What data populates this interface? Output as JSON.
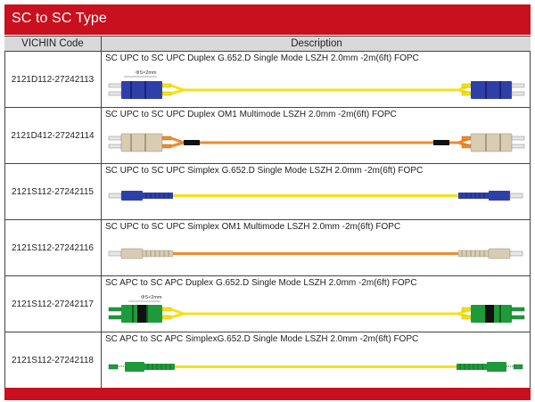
{
  "page": {
    "title": "SC to SC Type",
    "accent_color": "#c8101f",
    "header": {
      "code_label": "VICHIN Code",
      "desc_label": "Description"
    }
  },
  "rows": [
    {
      "code": "2121D112-27242113",
      "description": "SC UPC to SC UPC Duplex G.652.D Single Mode LSZH 2.0mm -2m(6ft) FOPC",
      "dim_label": "ΦS×2mm"
    },
    {
      "code": "2121D412-27242114",
      "description": "SC UPC to SC UPC Duplex OM1 Multimode LSZH 2.0mm -2m(6ft) FOPC"
    },
    {
      "code": "2121S112-27242115",
      "description": "SC UPC to SC UPC Simplex G.652.D Single Mode LSZH 2.0mm -2m(6ft) FOPC"
    },
    {
      "code": "2121S112-27242116",
      "description": "SC UPC to SC UPC Simplex OM1 Multimode LSZH 2.0mm -2m(6ft) FOPC"
    },
    {
      "code": "2121S112-27242117",
      "description": "SC APC to SC APC Duplex G.652.D Single Mode LSZH 2.0mm -2m(6ft) FOPC",
      "dim_label": "ΦS×2mm"
    },
    {
      "code": "2121S112-27242118",
      "description": "SC APC to SC APC SimplexG.652.D Single Mode LSZH 2.0mm -2m(6ft) FOPC"
    }
  ],
  "colors": {
    "single_mode_cable": "#f2e21b",
    "multimode_cable": "#ef8a2e",
    "upc_connector": "#2f3fa8",
    "om1_connector": "#d8cdb4",
    "apc_connector": "#1f9a3a",
    "boot_black": "#111111"
  }
}
